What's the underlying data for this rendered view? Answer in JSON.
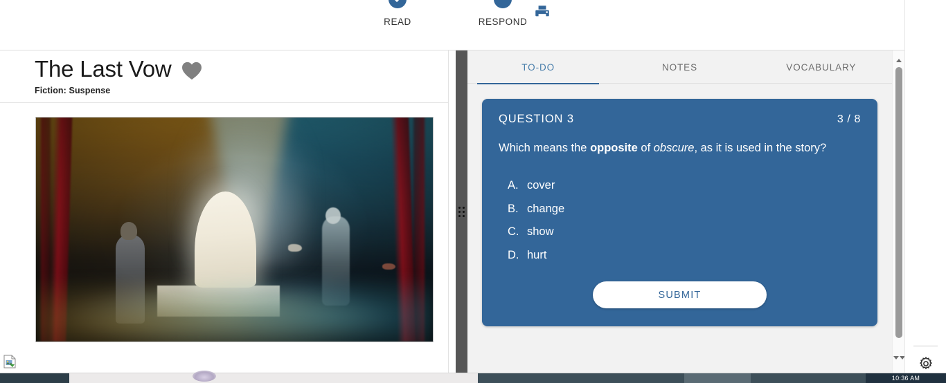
{
  "topbar": {
    "steps": [
      {
        "label": "READ",
        "state": "completed",
        "icon": "check-circle-icon"
      },
      {
        "label": "RESPOND",
        "state": "current",
        "icon": "filled-circle-icon"
      }
    ],
    "print_icon": "printer-icon",
    "print_label": "Print"
  },
  "story": {
    "title": "The Last Vow",
    "genre": "Fiction: Suspense",
    "favorite_icon": "heart-icon",
    "image_alt": "Stage scene with a draped ghost figure, two men, smoke and colored spotlights",
    "broken_image_icon": "broken-image-icon"
  },
  "panel": {
    "tabs": [
      {
        "label": "TO-DO",
        "active": true
      },
      {
        "label": "NOTES",
        "active": false
      },
      {
        "label": "VOCABULARY",
        "active": false
      }
    ]
  },
  "question": {
    "number_label": "QUESTION 3",
    "progress": "3 / 8",
    "prompt_part1": "Which means the ",
    "prompt_bold": "opposite",
    "prompt_part2": " of ",
    "prompt_italic": "obscure",
    "prompt_part3": ", as it is used in the story?",
    "options": [
      {
        "letter": "A.",
        "text": "cover"
      },
      {
        "letter": "B.",
        "text": "change"
      },
      {
        "letter": "C.",
        "text": "show"
      },
      {
        "letter": "D.",
        "text": "hurt"
      }
    ],
    "submit_label": "SUBMIT"
  },
  "rail": {
    "settings_icon": "gear-icon"
  },
  "taskbar": {
    "clock": "10:36 AM"
  },
  "colors": {
    "brand_blue": "#336699",
    "tab_active": "#4a7fab",
    "card_bg": "#336699",
    "submit_text": "#336699",
    "heart_gray": "#808080",
    "splitter": "#565656",
    "taskbar": "#20313f"
  },
  "scrollbars": {
    "left_up_icon": "triangle-up-icon",
    "left_down_icon": "triangle-down-icon",
    "right_up_icon": "triangle-up-icon",
    "right_down_icon": "triangle-down-icon"
  }
}
